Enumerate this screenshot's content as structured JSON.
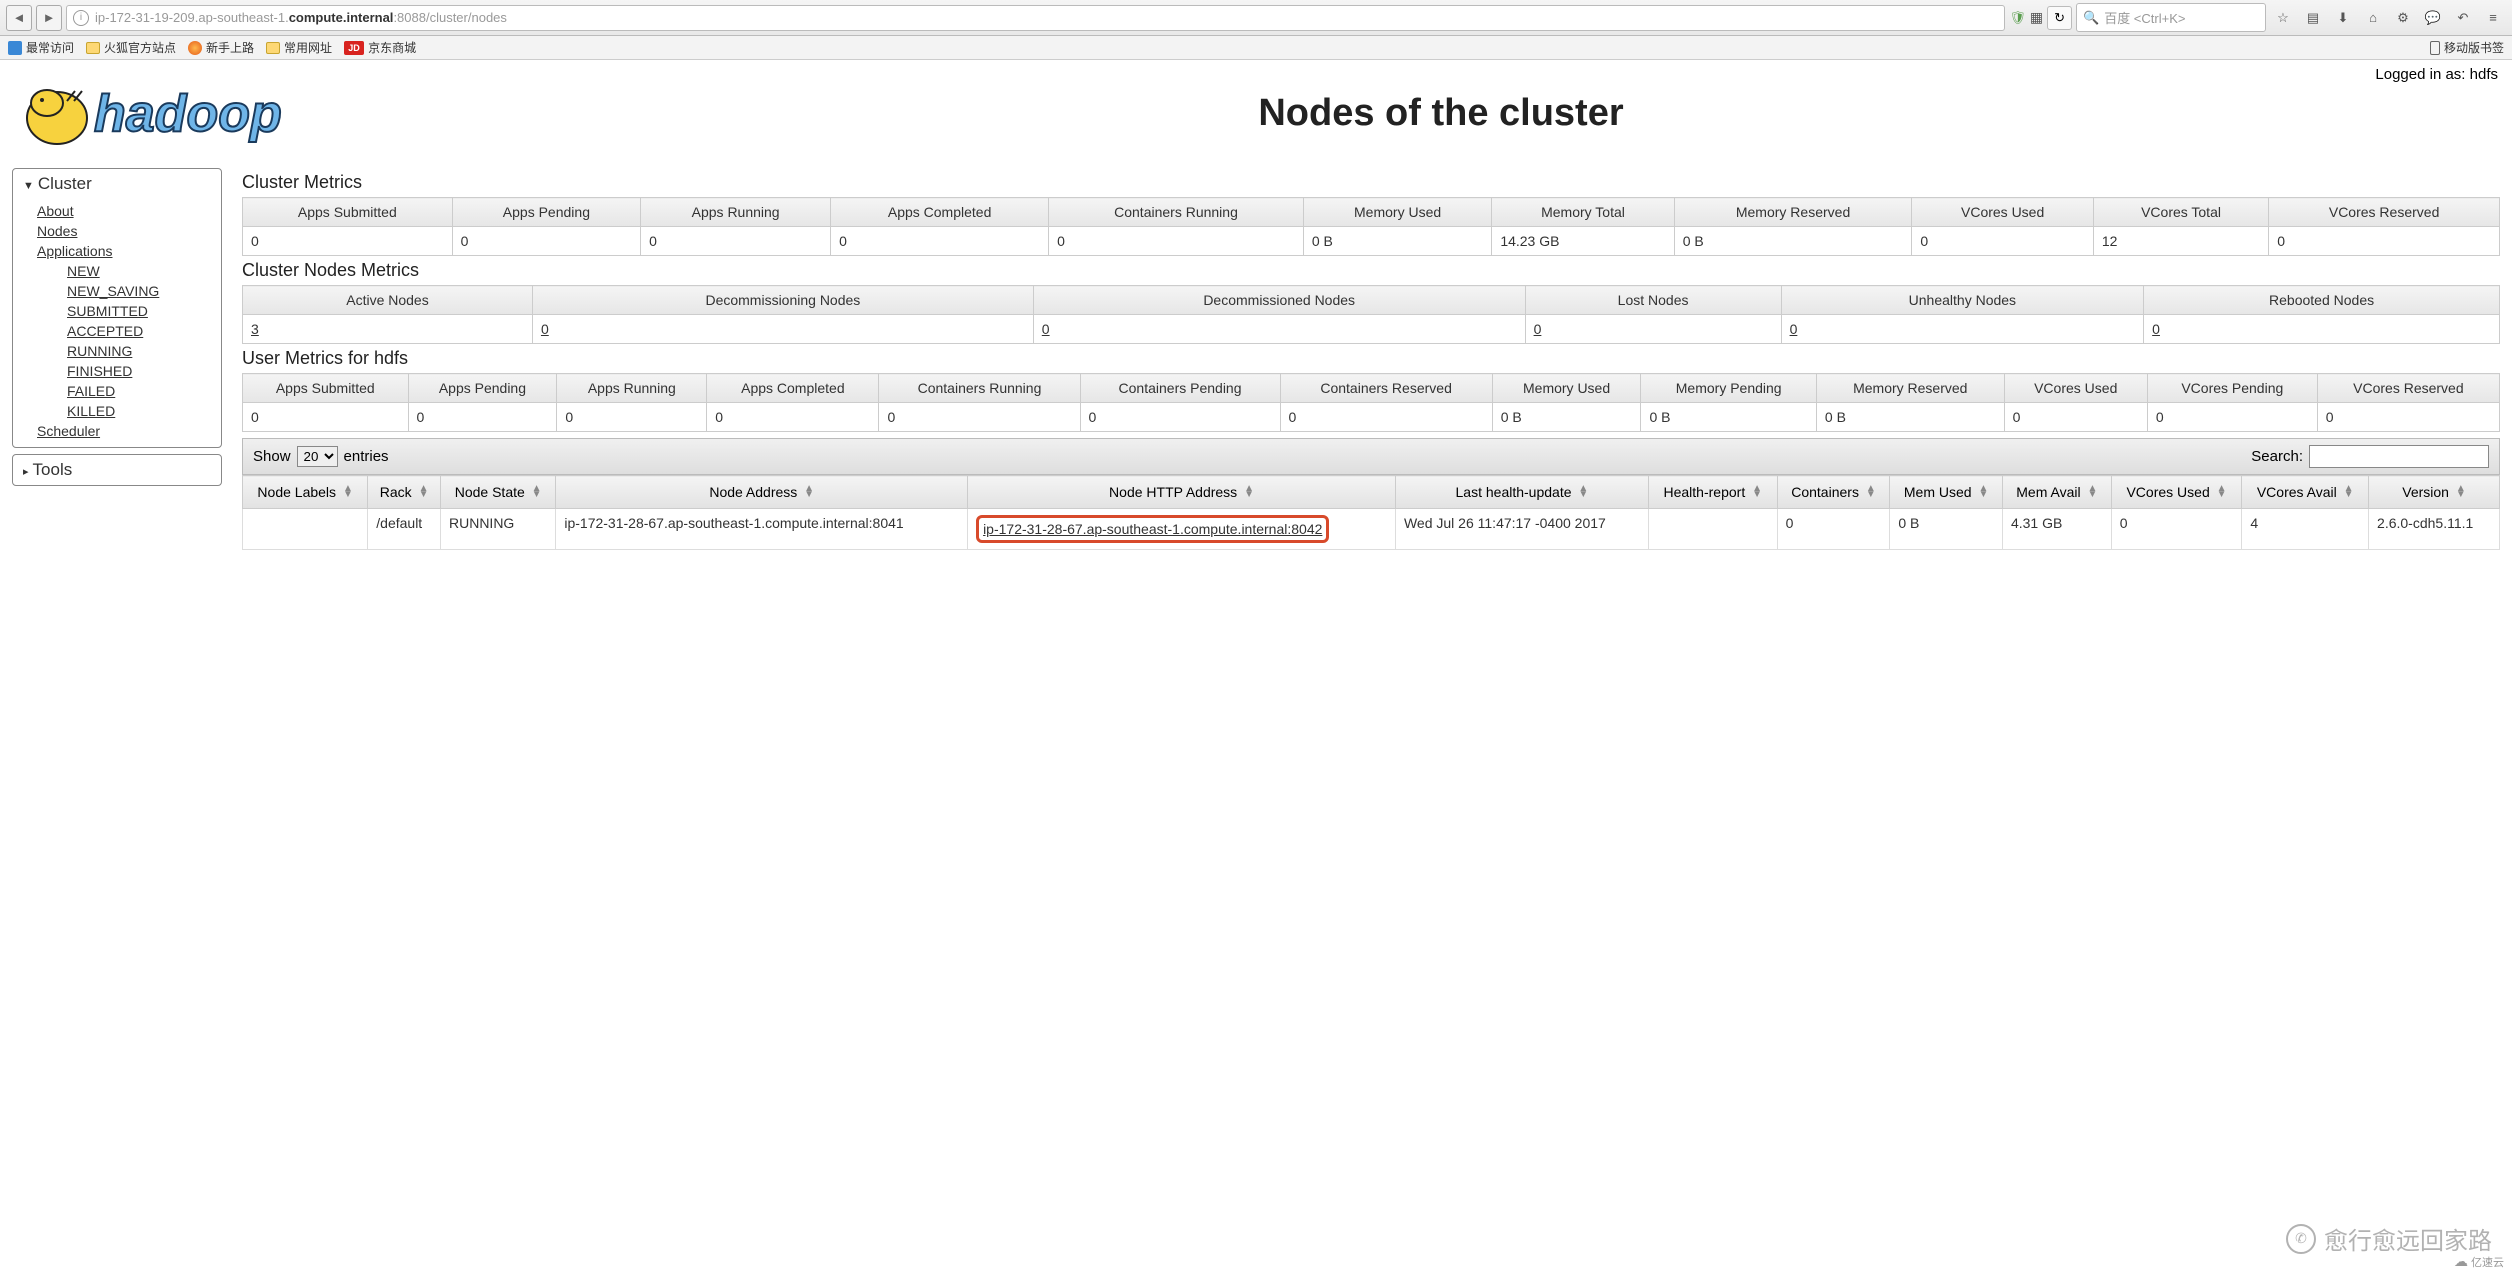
{
  "browser": {
    "url_prefix": "ip-172-31-19-209.ap-southeast-1.",
    "url_bold": "compute.internal",
    "url_suffix": ":8088/cluster/nodes",
    "search_placeholder": "百度 <Ctrl+K>"
  },
  "bookmarks": {
    "b1": "最常访问",
    "b2": "火狐官方站点",
    "b3": "新手上路",
    "b4": "常用网址",
    "b5": "京东商城",
    "jd": "JD",
    "mobile": "移动版书签"
  },
  "login": "Logged in as: hdfs",
  "title": "Nodes of the cluster",
  "sidebar": {
    "cluster": "Cluster",
    "about": "About",
    "nodes": "Nodes",
    "apps": "Applications",
    "new": "NEW",
    "new_saving": "NEW_SAVING",
    "submitted": "SUBMITTED",
    "accepted": "ACCEPTED",
    "running": "RUNNING",
    "finished": "FINISHED",
    "failed": "FAILED",
    "killed": "KILLED",
    "scheduler": "Scheduler",
    "tools": "Tools"
  },
  "sections": {
    "s1": "Cluster Metrics",
    "s2": "Cluster Nodes Metrics",
    "s3": "User Metrics for hdfs"
  },
  "cluster_metrics": {
    "headers": [
      "Apps Submitted",
      "Apps Pending",
      "Apps Running",
      "Apps Completed",
      "Containers Running",
      "Memory Used",
      "Memory Total",
      "Memory Reserved",
      "VCores Used",
      "VCores Total",
      "VCores Reserved"
    ],
    "values": [
      "0",
      "0",
      "0",
      "0",
      "0",
      "0 B",
      "14.23 GB",
      "0 B",
      "0",
      "12",
      "0"
    ]
  },
  "nodes_metrics": {
    "headers": [
      "Active Nodes",
      "Decommissioning Nodes",
      "Decommissioned Nodes",
      "Lost Nodes",
      "Unhealthy Nodes",
      "Rebooted Nodes"
    ],
    "values": [
      "3",
      "0",
      "0",
      "0",
      "0",
      "0"
    ]
  },
  "user_metrics": {
    "headers": [
      "Apps Submitted",
      "Apps Pending",
      "Apps Running",
      "Apps Completed",
      "Containers Running",
      "Containers Pending",
      "Containers Reserved",
      "Memory Used",
      "Memory Pending",
      "Memory Reserved",
      "VCores Used",
      "VCores Pending",
      "VCores Reserved"
    ],
    "values": [
      "0",
      "0",
      "0",
      "0",
      "0",
      "0",
      "0",
      "0 B",
      "0 B",
      "0 B",
      "0",
      "0",
      "0"
    ]
  },
  "showbar": {
    "show": "Show",
    "entries": "entries",
    "search": "Search:",
    "sel": "20"
  },
  "datatable": {
    "headers": [
      "Node Labels",
      "Rack",
      "Node State",
      "Node Address",
      "Node HTTP Address",
      "Last health-update",
      "Health-report",
      "Containers",
      "Mem Used",
      "Mem Avail",
      "VCores Used",
      "VCores Avail",
      "Version"
    ],
    "row": {
      "labels": "",
      "rack": "/default",
      "state": "RUNNING",
      "addr": "ip-172-31-28-67.ap-southeast-1.compute.internal:8041",
      "http": "ip-172-31-28-67.ap-southeast-1.compute.internal:8042",
      "last": "Wed Jul 26 11:47:17 -0400 2017",
      "report": "",
      "containers": "0",
      "memused": "0 B",
      "memavail": "4.31 GB",
      "vcused": "0",
      "vcavail": "4",
      "version": "2.6.0-cdh5.11.1"
    }
  },
  "watermark": "愈行愈远回家路",
  "corner": "亿速云"
}
